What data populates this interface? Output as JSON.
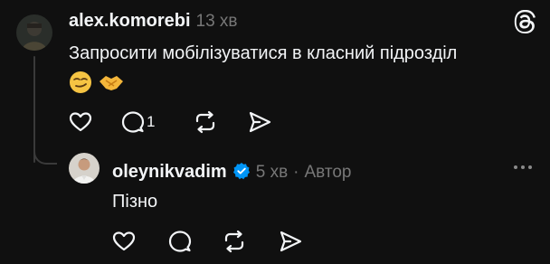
{
  "post": {
    "username": "alex.komorebi",
    "time": "13 хв",
    "text": "Запросити мобілізуватися в класний підрозділ",
    "emojis": [
      "smirking-face",
      "handshake"
    ],
    "reply_count": "1"
  },
  "reply": {
    "username": "oleynikvadim",
    "time": "5 хв",
    "separator": "·",
    "author_label": "Автор",
    "text": "Пізно"
  },
  "icons": {
    "logo": "threads-logo-icon",
    "like": "heart-icon",
    "comment": "comment-icon",
    "repost": "repost-icon",
    "share": "send-icon",
    "more": "more-icon",
    "verified": "verified-badge-icon"
  },
  "colors": {
    "background": "#101010",
    "text": "#f3f5f7",
    "muted": "#777777",
    "verified": "#0095f6",
    "line": "#3a3a3a"
  }
}
